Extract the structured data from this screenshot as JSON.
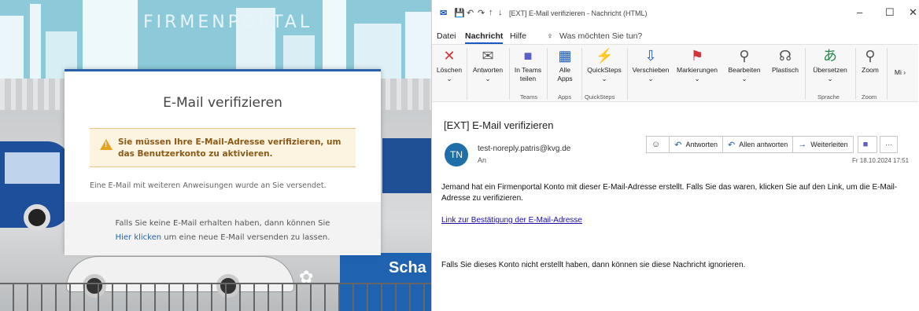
{
  "portal": {
    "brand": "FIRMENPORTAL",
    "card_title": "E-Mail verifizieren",
    "alert": "Sie müssen Ihre E-Mail-Adresse verifizieren, um das Benutzerkonto zu aktivieren.",
    "info": "Eine E-Mail mit weiteren Anweisungen wurde an Sie versendet.",
    "footer_line1": "Falls Sie keine E-Mail erhalten haben, dann können Sie",
    "footer_link": "Hier klicken",
    "footer_rest": " um eine neue E-Mail versenden zu lassen.",
    "bus_text": "Scha"
  },
  "outlook": {
    "window_title": "[EXT] E-Mail verifizieren  -  Nachricht (HTML)",
    "window_controls": [
      "–",
      "☐",
      "✕"
    ],
    "menu": [
      "Datei",
      "Nachricht",
      "Hilfe"
    ],
    "search_placeholder": "Was möchten Sie tun?",
    "ribbon": [
      {
        "label": "Löschen",
        "icon": "✕",
        "color": "#d13438"
      },
      {
        "label": "Antworten",
        "icon": "✉",
        "color": "#555"
      },
      {
        "label": "In Teams teilen",
        "icon": "■",
        "color": "#5b5fc7"
      },
      {
        "label": "Alle Apps",
        "icon": "▦",
        "color": "#185abd"
      },
      {
        "label": "QuickSteps",
        "icon": "⚡",
        "color": "#e8a317"
      },
      {
        "label": "Verschieben",
        "icon": "⇩",
        "color": "#185abd"
      },
      {
        "label": "Markierungen",
        "icon": "⚑",
        "color": "#d13438"
      },
      {
        "label": "Bearbeiten",
        "icon": "⚲",
        "color": "#555"
      },
      {
        "label": "Plastisch",
        "icon": "☊",
        "color": "#555"
      },
      {
        "label": "Übersetzen",
        "icon": "あ",
        "color": "#1f8e4e"
      },
      {
        "label": "Zoom",
        "icon": "⚲",
        "color": "#555"
      },
      {
        "label": "Mi",
        "icon": "",
        "color": "#555"
      }
    ],
    "ribbon_groups": [
      "Teams",
      "Apps",
      "QuickSteps",
      "Sprache",
      "Zoom"
    ],
    "subject": "[EXT] E-Mail verifizieren",
    "avatar": "TN",
    "sender": "test-noreply.patris@kvg.de",
    "to": "An",
    "actions": [
      "Antworten",
      "Allen antworten",
      "Weiterleiten"
    ],
    "date": "Fr 18.10.2024 17:51",
    "body1": "Jemand hat ein Firmenportal Konto mit dieser E-Mail-Adresse erstellt. Falls Sie das waren, klicken Sie auf den Link, um die E-Mail-Adresse zu verifizieren.",
    "link": "Link zur Bestätigung der E-Mail-Adresse",
    "body2": "Falls Sie dieses Konto nicht erstellt haben, dann können sie diese Nachricht ignorieren."
  }
}
